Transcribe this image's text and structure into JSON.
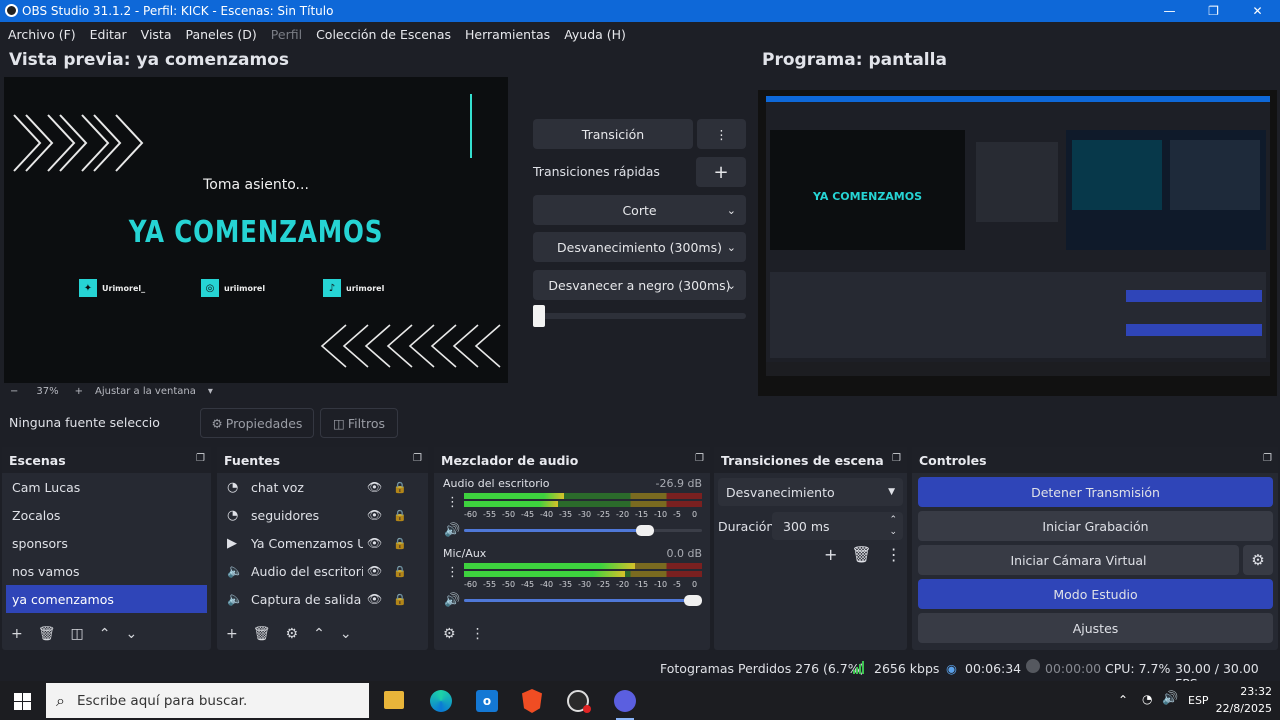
{
  "window": {
    "title": "OBS Studio 31.1.2 - Perfil: KICK - Escenas: Sin Título",
    "minimize": "—",
    "maximize": "❐",
    "close": "✕"
  },
  "menu": [
    "Archivo (F)",
    "Editar",
    "Vista",
    "Paneles (D)",
    "Perfil",
    "Colección de Escenas",
    "Herramientas",
    "Ayuda (H)"
  ],
  "preview": {
    "title": "Vista previa: ya comenzamos",
    "subtitle": "Toma asiento...",
    "headline": "YA COMENZAMOS",
    "socials": [
      {
        "handle": "Urimorel_",
        "icon": "twitter-icon"
      },
      {
        "handle": "uriimorel",
        "icon": "instagram-icon"
      },
      {
        "handle": "urimorel",
        "icon": "tiktok-icon"
      }
    ],
    "zoom_minus": "−",
    "zoom": "37%",
    "zoom_plus": "+",
    "fit": "Ajustar a la ventana",
    "fit_caret": "▾"
  },
  "program": {
    "title": "Programa: pantalla"
  },
  "transitions_mid": {
    "transition_btn": "Transición",
    "more": "⋮",
    "quick": "Transiciones rápidas",
    "add": "+",
    "items": [
      "Corte",
      "Desvanecimiento (300ms)",
      "Desvanecer a negro (300ms)"
    ],
    "chev": "⌄"
  },
  "source_bar": {
    "none": "Ninguna fuente seleccionad",
    "properties": "Propiedades",
    "filters": "Filtros"
  },
  "scenes": {
    "title": "Escenas",
    "items": [
      "Cam Lucas",
      "Zocalos",
      "sponsors",
      "nos vamos",
      "ya comenzamos"
    ],
    "selected": 4
  },
  "sources": {
    "title": "Fuentes",
    "items": [
      {
        "name": "chat voz",
        "icon": "browser-icon"
      },
      {
        "name": "seguidores",
        "icon": "browser-icon"
      },
      {
        "name": "Ya Comenzamos Uri",
        "icon": "media-icon"
      },
      {
        "name": "Audio del escritorio",
        "icon": "speaker-icon"
      },
      {
        "name": "Captura de salida de",
        "icon": "speaker-icon"
      }
    ]
  },
  "mixer": {
    "title": "Mezclador de audio",
    "channels": [
      {
        "name": "Audio del escritorio",
        "db": "-26.9 dB",
        "level": 0.42,
        "volume": 0.8
      },
      {
        "name": "Mic/Aux",
        "db": "0.0 dB",
        "level": 0.72,
        "volume": 1.0
      }
    ],
    "scale": [
      "-60",
      "-55",
      "-50",
      "-45",
      "-40",
      "-35",
      "-30",
      "-25",
      "-20",
      "-15",
      "-10",
      "-5",
      "0"
    ]
  },
  "scene_transitions": {
    "title": "Transiciones de escena",
    "selected": "Desvanecimiento",
    "duration_label": "Duración",
    "duration": "300 ms"
  },
  "controls": {
    "title": "Controles",
    "stop_stream": "Detener Transmisión",
    "start_record": "Iniciar Grabación",
    "virtual_cam": "Iniciar Cámara Virtual",
    "studio": "Modo Estudio",
    "settings": "Ajustes"
  },
  "status": {
    "dropped": "Fotogramas Perdidos 276 (6.7%)",
    "kbps": "2656 kbps",
    "stream_time": "00:06:34",
    "rec_time": "00:00:00",
    "cpu": "CPU: 7.7%",
    "fps": "30.00 / 30.00 FPS"
  },
  "taskbar": {
    "search": "Escribe aquí para buscar.",
    "lang": "ESP",
    "time": "23:32",
    "date": "22/8/2025"
  },
  "colors": {
    "accent": "#2f45b8",
    "titlebar": "#0e68d8",
    "headline": "#26d4d4"
  }
}
